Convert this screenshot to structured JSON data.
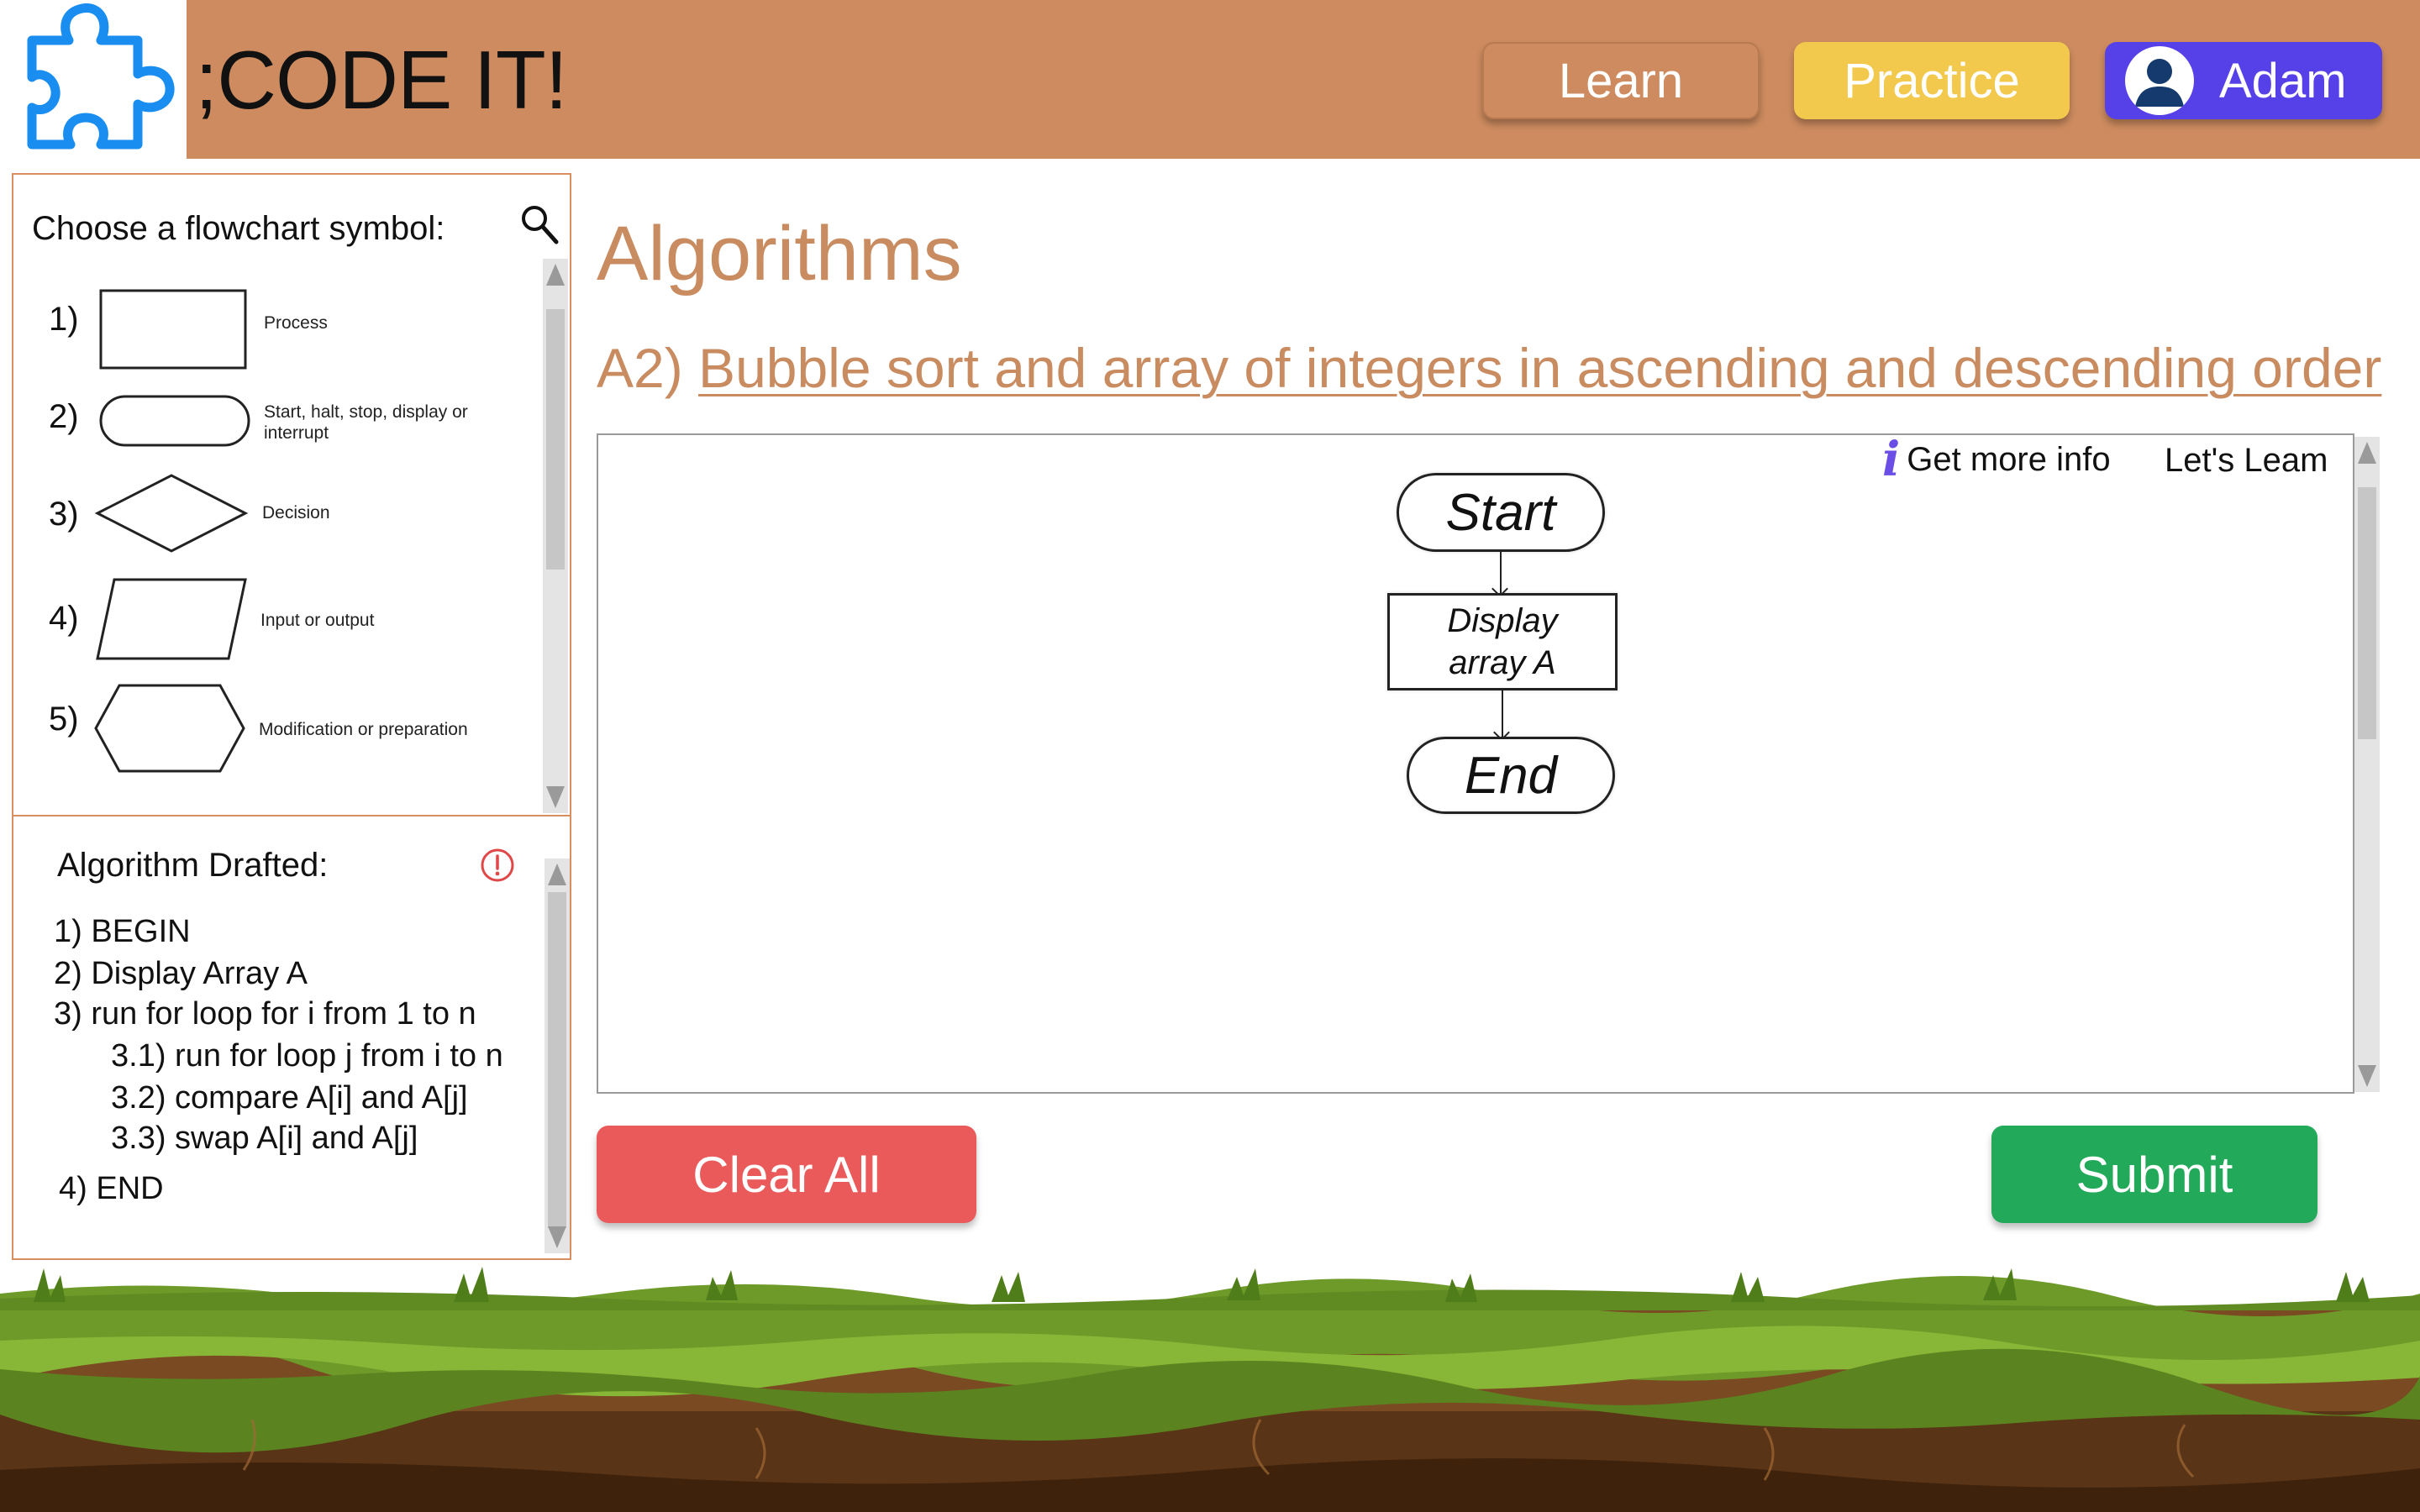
{
  "header": {
    "app_title": ";CODE IT!",
    "nav": {
      "learn_label": "Learn",
      "practice_label": "Practice",
      "user_name": "Adam"
    }
  },
  "symbol_panel": {
    "heading": "Choose a flowchart symbol:",
    "symbols": [
      {
        "number": "1)",
        "label": "Process"
      },
      {
        "number": "2)",
        "label": "Start, halt, stop, display or interrupt"
      },
      {
        "number": "3)",
        "label": "Decision"
      },
      {
        "number": "4)",
        "label": "Input or output"
      },
      {
        "number": "5)",
        "label": "Modification or preparation"
      }
    ]
  },
  "algorithm_panel": {
    "heading": "Algorithm Drafted:",
    "steps": [
      "1) BEGIN",
      "2) Display Array A",
      "3) run for loop for i from 1 to n",
      "3.1) run for loop j from i to n",
      "3.2) compare A[i] and A[j]",
      "3.3) swap A[i] and A[j]",
      "4) END"
    ]
  },
  "main": {
    "page_title": "Algorithms",
    "task_prefix": "A2) ",
    "task_title": "Bubble sort and array of integers in ascending and descending order",
    "canvas": {
      "info_icon": "i",
      "info_label": "Get more info",
      "learn_label": "Let's Leam",
      "flowchart": {
        "start": "Start",
        "process": "Display array A",
        "end": "End"
      }
    },
    "clear_label": "Clear All",
    "submit_label": "Submit"
  },
  "colors": {
    "header_bg": "#cd8b5f",
    "practice_bg": "#f2c94c",
    "user_bg": "#5640e8",
    "logo_blue": "#1a8ef0",
    "title_color": "#c98b60",
    "clear_bg": "#ea5a5a",
    "submit_bg": "#22a95a"
  },
  "icons": {
    "logo": "puzzle-piece-icon",
    "search": "search-icon",
    "alert": "alert-circle-icon",
    "info": "info-icon",
    "avatar": "user-avatar-icon"
  }
}
